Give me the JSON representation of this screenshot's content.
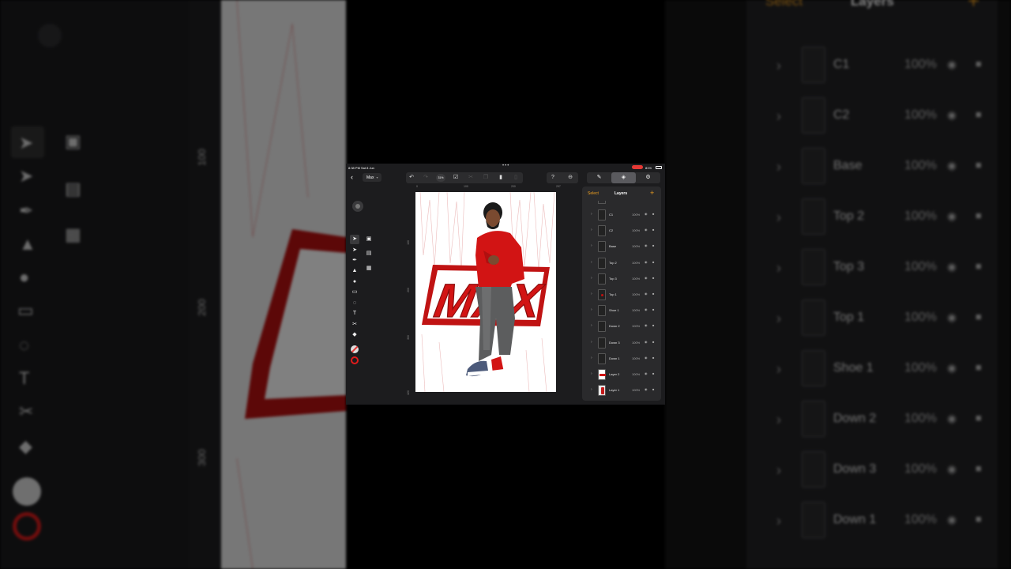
{
  "backdrop": {
    "ruler_marks": [
      "100",
      "200",
      "300"
    ],
    "layers_header": {
      "select": "Select",
      "title": "Layers",
      "add": "+"
    },
    "layers": [
      {
        "name": "C1",
        "opacity": "100%"
      },
      {
        "name": "C2",
        "opacity": "100%"
      },
      {
        "name": "Base",
        "opacity": "100%"
      },
      {
        "name": "Top 2",
        "opacity": "100%"
      },
      {
        "name": "Top 3",
        "opacity": "100%"
      },
      {
        "name": "Top 1",
        "opacity": "100%"
      },
      {
        "name": "Shoe 1",
        "opacity": "100%"
      },
      {
        "name": "Down 2",
        "opacity": "100%"
      },
      {
        "name": "Down 3",
        "opacity": "100%"
      },
      {
        "name": "Down 1",
        "opacity": "100%"
      }
    ]
  },
  "status_bar": {
    "time": "8:38 PM  Sat 8 Jun",
    "battery": "81%"
  },
  "toolbar": {
    "back_icon": "chevron-left-icon",
    "document_name": "Max",
    "zoom": "31%",
    "tabs": [
      "brush-icon",
      "layers-icon",
      "settings-icon"
    ],
    "active_tab": "layers-icon"
  },
  "rulers": {
    "horizontal": [
      "0",
      "100",
      "200",
      "297"
    ],
    "vertical": [
      "100",
      "200",
      "300",
      "420"
    ]
  },
  "artwork": {
    "logo_text": "MAX",
    "colors": {
      "red": "#d21414",
      "dark_red": "#8a0c0c",
      "skin": "#7a4a30",
      "pants": "#5c5d5e"
    }
  },
  "layers_panel": {
    "select_label": "Select",
    "title": "Layers",
    "add_label": "+",
    "layers": [
      {
        "name": "C1",
        "opacity": "100%",
        "thumb": ""
      },
      {
        "name": "C2",
        "opacity": "100%",
        "thumb": ""
      },
      {
        "name": "Base",
        "opacity": "100%",
        "thumb": ""
      },
      {
        "name": "Top 2",
        "opacity": "100%",
        "thumb": ""
      },
      {
        "name": "Top 3",
        "opacity": "100%",
        "thumb": ""
      },
      {
        "name": "Top 1",
        "opacity": "100%",
        "thumb": "red"
      },
      {
        "name": "Shoe 1",
        "opacity": "100%",
        "thumb": ""
      },
      {
        "name": "Down 2",
        "opacity": "100%",
        "thumb": ""
      },
      {
        "name": "Down 3",
        "opacity": "100%",
        "thumb": ""
      },
      {
        "name": "Down 1",
        "opacity": "100%",
        "thumb": ""
      },
      {
        "name": "Layer 2",
        "opacity": "100%",
        "thumb": "logo"
      },
      {
        "name": "Layer 1",
        "opacity": "100%",
        "thumb": "pic"
      }
    ]
  }
}
